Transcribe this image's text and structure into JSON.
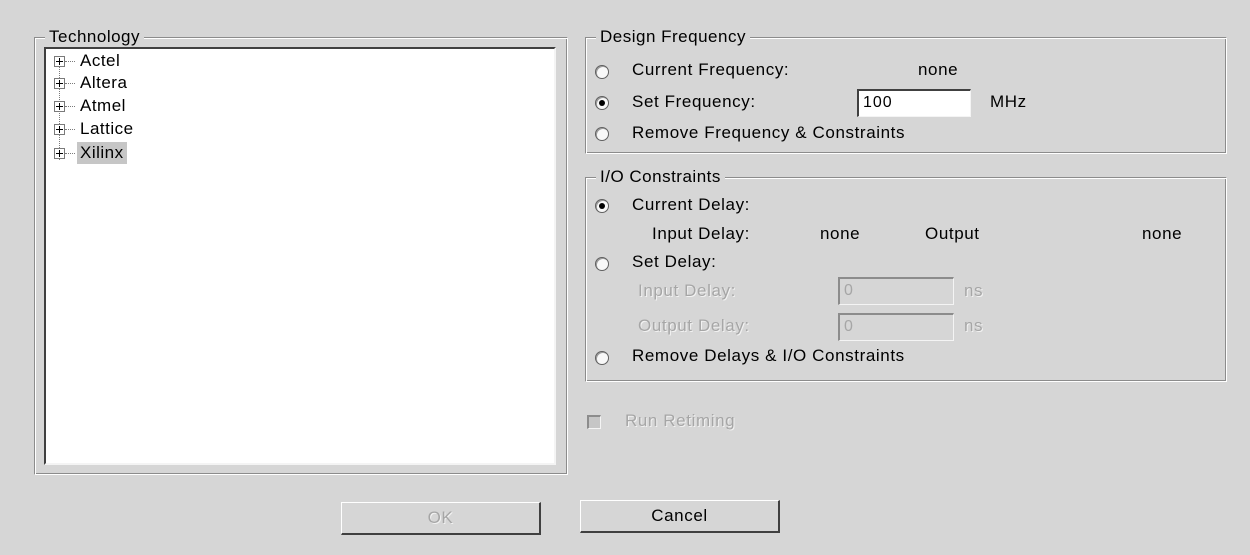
{
  "technology": {
    "title": "Technology",
    "items": [
      {
        "label": "Actel"
      },
      {
        "label": "Altera"
      },
      {
        "label": "Atmel"
      },
      {
        "label": "Lattice"
      },
      {
        "label": "Xilinx",
        "selected": true
      }
    ]
  },
  "design_frequency": {
    "title": "Design Frequency",
    "current_label": "Current Frequency:",
    "current_value": "none",
    "set_label": "Set Frequency:",
    "set_value": "100",
    "unit": "MHz",
    "remove_label": "Remove Frequency & Constraints",
    "selected": "set"
  },
  "io_constraints": {
    "title": "I/O Constraints",
    "current_label": "Current Delay:",
    "input_delay_label": "Input Delay:",
    "input_delay_value": "none",
    "output_label": "Output",
    "output_value": "none",
    "set_label": "Set Delay:",
    "input_field_label": "Input Delay:",
    "input_field_value": "0",
    "output_field_label": "Output Delay:",
    "output_field_value": "0",
    "unit": "ns",
    "remove_label": "Remove Delays & I/O Constraints",
    "selected": "current"
  },
  "run_retiming": {
    "label": "Run Retiming",
    "checked": false,
    "enabled": false
  },
  "buttons": {
    "ok": "OK",
    "cancel": "Cancel"
  }
}
